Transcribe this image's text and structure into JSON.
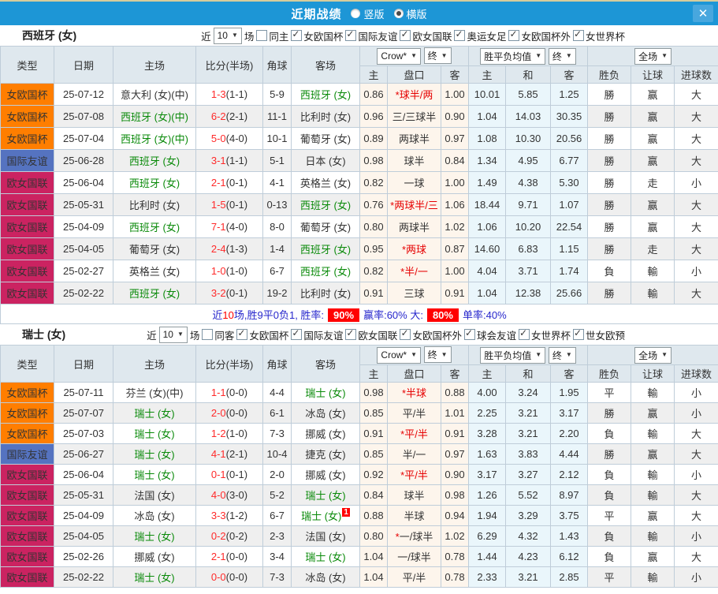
{
  "header": {
    "title": "近期战绩",
    "layout_vertical": "竖版",
    "layout_horizontal": "横版",
    "close_glyph": "✕",
    "accent_color": "#1d96d6"
  },
  "table_head": {
    "main_cols": [
      "类型",
      "日期",
      "主场",
      "比分(半场)",
      "角球",
      "客场"
    ],
    "odds_source": "Crow*",
    "odds_final": "终",
    "avg_label": "胜平负均值",
    "avg_final": "终",
    "scope": "全场",
    "arrow": "▼",
    "sub_cols": [
      "主",
      "盘口",
      "客",
      "主",
      "和",
      "客",
      "胜负",
      "让球",
      "进球数"
    ]
  },
  "type_colors": {
    "euro": "#ff7e00",
    "friendly": "#5573c0",
    "league": "#cb2361"
  },
  "sections": [
    {
      "team": "西班牙 (女)",
      "filter": {
        "near": "近",
        "count": "10",
        "suffix": "场",
        "same": "同主",
        "competitions": [
          "女欧国杯",
          "国际友谊",
          "欧女国联",
          "奥运女足",
          "女欧国杯外",
          "女世界杯"
        ]
      },
      "rows": [
        {
          "t": "女欧国杯",
          "k": "euro",
          "d": "25-07-12",
          "h": "意大利 (女)(中)",
          "hs": false,
          "ft": "1-3",
          "ht": "(1-1)",
          "cr": "5-9",
          "a": "西班牙 (女)",
          "as": true,
          "nb": "",
          "o1": "0.86",
          "hc": "*球半/两",
          "hr": true,
          "o2": "1.00",
          "m1": "10.01",
          "m2": "5.85",
          "m3": "1.25",
          "r1": "勝",
          "r2": "赢",
          "r3": "大"
        },
        {
          "t": "女欧国杯",
          "k": "euro",
          "d": "25-07-08",
          "h": "西班牙 (女)(中)",
          "hs": true,
          "ft": "6-2",
          "ht": "(2-1)",
          "cr": "11-1",
          "a": "比利时 (女)",
          "as": false,
          "nb": "",
          "o1": "0.96",
          "hc": "三/三球半",
          "hr": false,
          "o2": "0.90",
          "m1": "1.04",
          "m2": "14.03",
          "m3": "30.35",
          "r1": "勝",
          "r2": "赢",
          "r3": "大"
        },
        {
          "t": "女欧国杯",
          "k": "euro",
          "d": "25-07-04",
          "h": "西班牙 (女)(中)",
          "hs": true,
          "ft": "5-0",
          "ht": "(4-0)",
          "cr": "10-1",
          "a": "葡萄牙 (女)",
          "as": false,
          "nb": "",
          "o1": "0.89",
          "hc": "两球半",
          "hr": false,
          "o2": "0.97",
          "m1": "1.08",
          "m2": "10.30",
          "m3": "20.56",
          "r1": "勝",
          "r2": "赢",
          "r3": "大"
        },
        {
          "t": "国际友谊",
          "k": "friendly",
          "d": "25-06-28",
          "h": "西班牙 (女)",
          "hs": true,
          "ft": "3-1",
          "ht": "(1-1)",
          "cr": "5-1",
          "a": "日本 (女)",
          "as": false,
          "nb": "",
          "o1": "0.98",
          "hc": "球半",
          "hr": false,
          "o2": "0.84",
          "m1": "1.34",
          "m2": "4.95",
          "m3": "6.77",
          "r1": "勝",
          "r2": "赢",
          "r3": "大"
        },
        {
          "t": "欧女国联",
          "k": "league",
          "d": "25-06-04",
          "h": "西班牙 (女)",
          "hs": true,
          "ft": "2-1",
          "ht": "(0-1)",
          "cr": "4-1",
          "a": "英格兰 (女)",
          "as": false,
          "nb": "",
          "o1": "0.82",
          "hc": "一球",
          "hr": false,
          "o2": "1.00",
          "m1": "1.49",
          "m2": "4.38",
          "m3": "5.30",
          "r1": "勝",
          "r2": "走",
          "r3": "小"
        },
        {
          "t": "欧女国联",
          "k": "league",
          "d": "25-05-31",
          "h": "比利时 (女)",
          "hs": false,
          "ft": "1-5",
          "ht": "(0-1)",
          "cr": "0-13",
          "a": "西班牙 (女)",
          "as": true,
          "nb": "",
          "o1": "0.76",
          "hc": "*两球半/三",
          "hr": true,
          "o2": "1.06",
          "m1": "18.44",
          "m2": "9.71",
          "m3": "1.07",
          "r1": "勝",
          "r2": "赢",
          "r3": "大"
        },
        {
          "t": "欧女国联",
          "k": "league",
          "d": "25-04-09",
          "h": "西班牙 (女)",
          "hs": true,
          "ft": "7-1",
          "ht": "(4-0)",
          "cr": "8-0",
          "a": "葡萄牙 (女)",
          "as": false,
          "nb": "",
          "o1": "0.80",
          "hc": "两球半",
          "hr": false,
          "o2": "1.02",
          "m1": "1.06",
          "m2": "10.20",
          "m3": "22.54",
          "r1": "勝",
          "r2": "赢",
          "r3": "大"
        },
        {
          "t": "欧女国联",
          "k": "league",
          "d": "25-04-05",
          "h": "葡萄牙 (女)",
          "hs": false,
          "ft": "2-4",
          "ht": "(1-3)",
          "cr": "1-4",
          "a": "西班牙 (女)",
          "as": true,
          "nb": "",
          "o1": "0.95",
          "hc": "*两球",
          "hr": true,
          "o2": "0.87",
          "m1": "14.60",
          "m2": "6.83",
          "m3": "1.15",
          "r1": "勝",
          "r2": "走",
          "r3": "大"
        },
        {
          "t": "欧女国联",
          "k": "league",
          "d": "25-02-27",
          "h": "英格兰 (女)",
          "hs": false,
          "ft": "1-0",
          "ht": "(1-0)",
          "cr": "6-7",
          "a": "西班牙 (女)",
          "as": true,
          "nb": "",
          "o1": "0.82",
          "hc": "*半/一",
          "hr": true,
          "o2": "1.00",
          "m1": "4.04",
          "m2": "3.71",
          "m3": "1.74",
          "r1": "負",
          "r2": "輸",
          "r3": "小"
        },
        {
          "t": "欧女国联",
          "k": "league",
          "d": "25-02-22",
          "h": "西班牙 (女)",
          "hs": true,
          "ft": "3-2",
          "ht": "(0-1)",
          "cr": "19-2",
          "a": "比利时 (女)",
          "as": false,
          "nb": "",
          "o1": "0.91",
          "hc": "三球",
          "hr": false,
          "o2": "0.91",
          "m1": "1.04",
          "m2": "12.38",
          "m3": "25.66",
          "r1": "勝",
          "r2": "輸",
          "r3": "大"
        }
      ],
      "summary": [
        {
          "t": "近",
          "k": "b"
        },
        {
          "t": "10",
          "k": "r"
        },
        {
          "t": "场,胜9平0负1, 胜率:",
          "k": "b"
        },
        {
          "t": "90%",
          "k": "hl"
        },
        {
          "t": "赢率:",
          "k": "b"
        },
        {
          "t": "60%",
          "k": "b"
        },
        {
          "t": " 大:",
          "k": "b"
        },
        {
          "t": "80%",
          "k": "hl"
        },
        {
          "t": "单率:",
          "k": "b"
        },
        {
          "t": "40%",
          "k": "b"
        }
      ]
    },
    {
      "team": "瑞士 (女)",
      "filter": {
        "near": "近",
        "count": "10",
        "suffix": "场",
        "same": "同客",
        "competitions": [
          "女欧国杯",
          "国际友谊",
          "欧女国联",
          "女欧国杯外",
          "球会友谊",
          "女世界杯",
          "世女欧预"
        ]
      },
      "rows": [
        {
          "t": "女欧国杯",
          "k": "euro",
          "d": "25-07-11",
          "h": "芬兰 (女)(中)",
          "hs": false,
          "ft": "1-1",
          "ht": "(0-0)",
          "cr": "4-4",
          "a": "瑞士 (女)",
          "as": true,
          "nb": "",
          "o1": "0.98",
          "hc": "*半球",
          "hr": true,
          "o2": "0.88",
          "m1": "4.00",
          "m2": "3.24",
          "m3": "1.95",
          "r1": "平",
          "r2": "輸",
          "r3": "小"
        },
        {
          "t": "女欧国杯",
          "k": "euro",
          "d": "25-07-07",
          "h": "瑞士 (女)",
          "hs": true,
          "ft": "2-0",
          "ht": "(0-0)",
          "cr": "6-1",
          "a": "冰岛 (女)",
          "as": false,
          "nb": "",
          "o1": "0.85",
          "hc": "平/半",
          "hr": false,
          "o2": "1.01",
          "m1": "2.25",
          "m2": "3.21",
          "m3": "3.17",
          "r1": "勝",
          "r2": "赢",
          "r3": "小"
        },
        {
          "t": "女欧国杯",
          "k": "euro",
          "d": "25-07-03",
          "h": "瑞士 (女)",
          "hs": true,
          "ft": "1-2",
          "ht": "(1-0)",
          "cr": "7-3",
          "a": "挪威 (女)",
          "as": false,
          "nb": "",
          "o1": "0.91",
          "hc": "*平/半",
          "hr": true,
          "o2": "0.91",
          "m1": "3.28",
          "m2": "3.21",
          "m3": "2.20",
          "r1": "負",
          "r2": "輸",
          "r3": "大"
        },
        {
          "t": "国际友谊",
          "k": "friendly",
          "d": "25-06-27",
          "h": "瑞士 (女)",
          "hs": true,
          "ft": "4-1",
          "ht": "(2-1)",
          "cr": "10-4",
          "a": "捷克 (女)",
          "as": false,
          "nb": "",
          "o1": "0.85",
          "hc": "半/一",
          "hr": false,
          "o2": "0.97",
          "m1": "1.63",
          "m2": "3.83",
          "m3": "4.44",
          "r1": "勝",
          "r2": "赢",
          "r3": "大"
        },
        {
          "t": "欧女国联",
          "k": "league",
          "d": "25-06-04",
          "h": "瑞士 (女)",
          "hs": true,
          "ft": "0-1",
          "ht": "(0-1)",
          "cr": "2-0",
          "a": "挪威 (女)",
          "as": false,
          "nb": "",
          "o1": "0.92",
          "hc": "*平/半",
          "hr": true,
          "o2": "0.90",
          "m1": "3.17",
          "m2": "3.27",
          "m3": "2.12",
          "r1": "負",
          "r2": "輸",
          "r3": "小"
        },
        {
          "t": "欧女国联",
          "k": "league",
          "d": "25-05-31",
          "h": "法国 (女)",
          "hs": false,
          "ft": "4-0",
          "ht": "(3-0)",
          "cr": "5-2",
          "a": "瑞士 (女)",
          "as": true,
          "nb": "",
          "o1": "0.84",
          "hc": "球半",
          "hr": false,
          "o2": "0.98",
          "m1": "1.26",
          "m2": "5.52",
          "m3": "8.97",
          "r1": "負",
          "r2": "輸",
          "r3": "大"
        },
        {
          "t": "欧女国联",
          "k": "league",
          "d": "25-04-09",
          "h": "冰岛 (女)",
          "hs": false,
          "ft": "3-3",
          "ht": "(1-2)",
          "cr": "6-7",
          "a": "瑞士 (女)",
          "as": true,
          "nb": "1",
          "o1": "0.88",
          "hc": "半球",
          "hr": false,
          "o2": "0.94",
          "m1": "1.94",
          "m2": "3.29",
          "m3": "3.75",
          "r1": "平",
          "r2": "赢",
          "r3": "大"
        },
        {
          "t": "欧女国联",
          "k": "league",
          "d": "25-04-05",
          "h": "瑞士 (女)",
          "hs": true,
          "ft": "0-2",
          "ht": "(0-2)",
          "cr": "2-3",
          "a": "法国 (女)",
          "as": false,
          "nb": "",
          "o1": "0.80",
          "hc": "*一/球半",
          "hr": false,
          "o2": "1.02",
          "m1": "6.29",
          "m2": "4.32",
          "m3": "1.43",
          "r1": "負",
          "r2": "輸",
          "r3": "小"
        },
        {
          "t": "欧女国联",
          "k": "league",
          "d": "25-02-26",
          "h": "挪威 (女)",
          "hs": false,
          "ft": "2-1",
          "ht": "(0-0)",
          "cr": "3-4",
          "a": "瑞士 (女)",
          "as": true,
          "nb": "",
          "o1": "1.04",
          "hc": "一/球半",
          "hr": false,
          "o2": "0.78",
          "m1": "1.44",
          "m2": "4.23",
          "m3": "6.12",
          "r1": "負",
          "r2": "赢",
          "r3": "大"
        },
        {
          "t": "欧女国联",
          "k": "league",
          "d": "25-02-22",
          "h": "瑞士 (女)",
          "hs": true,
          "ft": "0-0",
          "ht": "(0-0)",
          "cr": "7-3",
          "a": "冰岛 (女)",
          "as": false,
          "nb": "",
          "o1": "1.04",
          "hc": "平/半",
          "hr": false,
          "o2": "0.78",
          "m1": "2.33",
          "m2": "3.21",
          "m3": "2.85",
          "r1": "平",
          "r2": "輸",
          "r3": "小"
        }
      ],
      "summary": null
    }
  ]
}
